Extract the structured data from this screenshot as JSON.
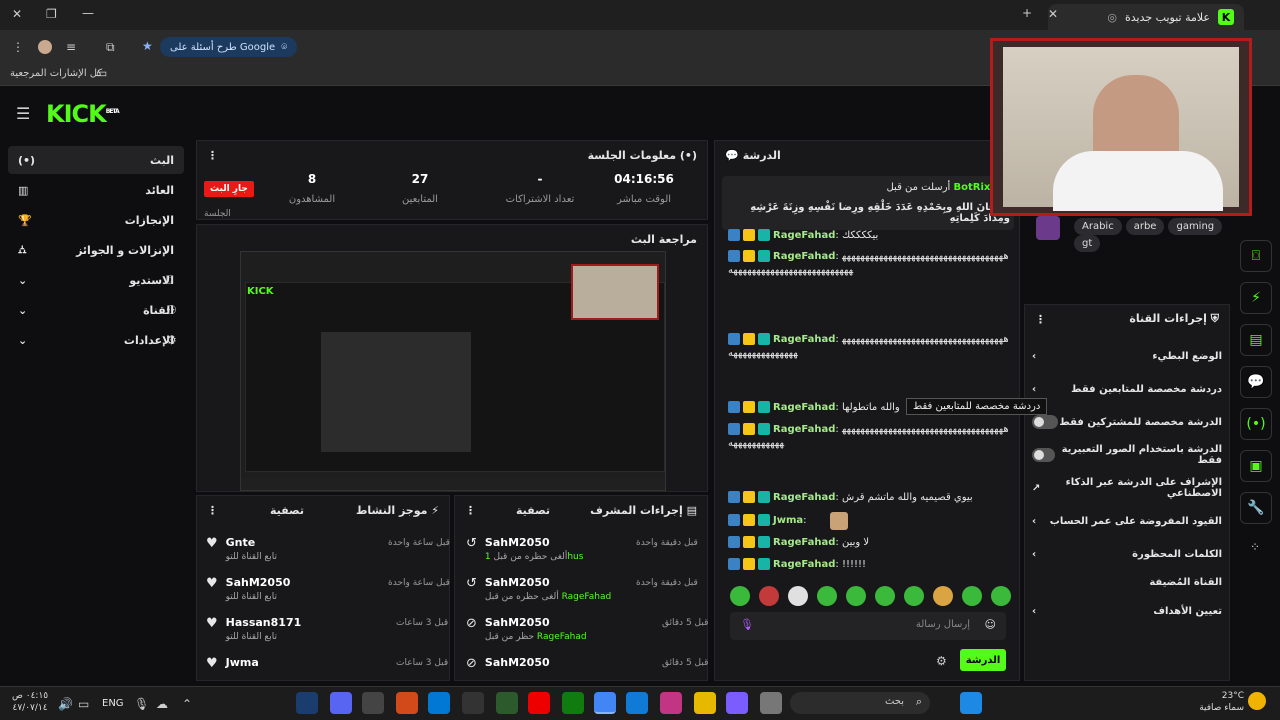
{
  "browser": {
    "tab_title": "علامة تبويب جديدة",
    "bookmark_label": "كل الإشارات المرجعية",
    "google_pill": "طرح أسئلة على Google"
  },
  "kick": {
    "logo": "KICK",
    "logo_sup": "BETA"
  },
  "sidebar": {
    "items": [
      {
        "label": "البث"
      },
      {
        "label": "العائد"
      },
      {
        "label": "الإنجازات"
      },
      {
        "label": "الإنزالات و الجوائز"
      },
      {
        "label": "الاستديو"
      },
      {
        "label": "القناة"
      },
      {
        "label": "الإعدادات"
      }
    ]
  },
  "session": {
    "title": "معلومات الجلسة",
    "live_badge": "جارِ البث",
    "session_label": "الجلسة",
    "stats": [
      {
        "value": "8",
        "label": "المشاهدون"
      },
      {
        "value": "27",
        "label": "المتابعين"
      },
      {
        "value": "-",
        "label": "تعداد الاشتراكات"
      },
      {
        "value": "04:16:56",
        "label": "الوقت مباشر"
      }
    ]
  },
  "review": {
    "title": "مراجعة البث"
  },
  "activity": {
    "title": "موجز النشاط",
    "filter": "تصفية",
    "items": [
      {
        "name": "Gnte",
        "sub": "تابع القناة للتو",
        "time": "قبل ساعة واحدة"
      },
      {
        "name": "SahM2050",
        "sub": "تابع القناة للتو",
        "time": "قبل ساعة واحدة"
      },
      {
        "name": "Hassan8171",
        "sub": "تابع القناة للتو",
        "time": "قبل 3 ساعات"
      },
      {
        "name": "Jwma",
        "sub": "",
        "time": "قبل 3 ساعات"
      }
    ]
  },
  "modactions": {
    "title": "إجراءات المشرف",
    "filter": "تصفية",
    "items": [
      {
        "name": "SahM2050",
        "sub": "ألغى حظره من قبل",
        "target": "1hus",
        "time": "قبل دقيقة واحدة"
      },
      {
        "name": "SahM2050",
        "sub": "ألغى حظره من قبل",
        "target": "RageFahad",
        "time": "قبل دقيقة واحدة"
      },
      {
        "name": "SahM2050",
        "sub": "حظر من قبل",
        "target": "RageFahad",
        "time": "قبل 5 دقائق"
      },
      {
        "name": "SahM2050",
        "sub": "",
        "target": "",
        "time": "قبل 5 دقائق"
      }
    ]
  },
  "chat": {
    "title": "الدرشة",
    "pinned_by": "أرسلت من قبل",
    "pinned_user": "BotRix",
    "pinned_text": "سُبحانَ اللهِ وبِحَمْدِهِ عَدَدَ خَلْقِهِ ورِضا نَفْسِهِ وزِنَةَ عَرْشِهِ ومِدادَ كَلِماتِهِ",
    "messages": [
      {
        "user": "RageFahad",
        "text": "بيككككك"
      },
      {
        "user": "RageFahad",
        "text": "ههههههههههههههههههههههههههههههههههههههههههههههههههههههههههههههه"
      },
      {
        "user": "RageFahad",
        "text": "ههههههههههههههههههههههههههههههههههههههههههههههههههه"
      },
      {
        "user": "RageFahad",
        "text": "والله ماتطولها"
      },
      {
        "user": "RageFahad",
        "text": "هههههههههههههههههههههههههههههههههههههههههههههههه"
      },
      {
        "user": "RageFahad",
        "text": "بيوي قصيميه والله ماتشم قرش"
      },
      {
        "user": "Jwma",
        "text": ""
      },
      {
        "user": "RageFahad",
        "text": "لا وبين"
      },
      {
        "user": "RageFahad",
        "text": "!!!!!!"
      }
    ],
    "input_placeholder": "إرسال رسالة",
    "send_button": "الدرشة"
  },
  "tags": [
    "Arabic",
    "arbe",
    "gaming",
    "gt"
  ],
  "channel_actions": {
    "title": "إجراءات القناة",
    "tooltip": "دردشة مخصصة للمتابعين فقط",
    "items": [
      {
        "label": "الوضع البطيء"
      },
      {
        "label": "دردشة مخصصة للمتابعين فقط"
      },
      {
        "label": "الدرشة مخصصة للمشتركين فقط"
      },
      {
        "label": "الدرشة باستخدام الصور التعبيرية فقط"
      },
      {
        "label": "الإشراف على الدرشة عبر الذكاء الاصطناعي"
      },
      {
        "label": "القيود المفروضة على عمر الحساب"
      },
      {
        "label": "الكلمات المحظورة"
      },
      {
        "label": "القناة المُضيفة"
      },
      {
        "label": "تعيين الأهداف"
      }
    ]
  },
  "taskbar": {
    "search": "بحث",
    "lang": "ENG",
    "time": "٠٤:١٥ ص",
    "date": "٤٧/٠٧/١٤",
    "weather_temp": "23°C",
    "weather_desc": "سماء صافية"
  }
}
